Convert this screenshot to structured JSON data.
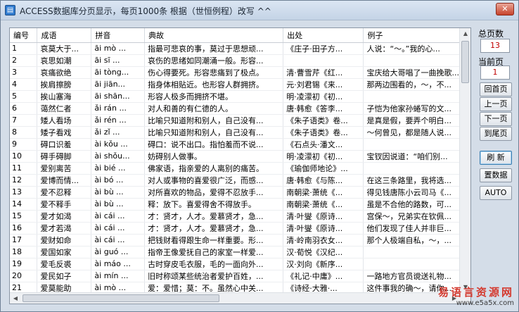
{
  "window": {
    "title": "ACCESS数据库分页显示，每页1000条 根据（世恒例程）改写 ^^",
    "close_label": "✕"
  },
  "grid": {
    "columns": [
      "编号",
      "成语",
      "拼音",
      "典故",
      "出处",
      "例子"
    ],
    "rows": [
      [
        "1",
        "哀莫大于...",
        "āi mò ...",
        "指最可悲哀的事，莫过于思想顽...",
        "《庄子·田子方...",
        "人说：“～。”我的心..."
      ],
      [
        "2",
        "哀思如潮",
        "āi sī ...",
        "哀伤的思绪如同潮涌一般。形容...",
        "",
        ""
      ],
      [
        "3",
        "哀痛欲绝",
        "āi tòng...",
        "伤心得要死。形容悲痛到了极点。",
        "清·曹雪芹《红...",
        "宝庆给大哥唱了一曲挽歌..."
      ],
      [
        "4",
        "挨肩擦膀",
        "āi jiān...",
        "指身体相贴近。也形容人群拥挤。",
        "元·刘君锡《来...",
        "那两边围看的，～，不..."
      ],
      [
        "5",
        "挨山塞海",
        "āi shān...",
        "形容人极多而拥挤不堪。",
        "明·凌濛初《初...",
        ""
      ],
      [
        "6",
        "蔼然仁者",
        "ǎi rán ...",
        "对人和善的有仁德的人。",
        "唐·韩愈《答李...",
        "子恺为他家孙蜷写的文..."
      ],
      [
        "7",
        "矮人看场",
        "ǎi rén ...",
        "比喻只知道附和别人，自己没有...",
        "《朱子语类》卷...",
        "是真是假，要弄个明白..."
      ],
      [
        "8",
        "矮子看戏",
        "ǎi zǐ ...",
        "比喻只知道附和别人，自己没有...",
        "《朱子语类》卷...",
        "～何曾见，都是随人说..."
      ],
      [
        "9",
        "碍口识羞",
        "ài kǒu ...",
        "碍口：说不出口。指怕羞而不说...",
        "《石点头·潘文...",
        ""
      ],
      [
        "10",
        "碍手碍脚",
        "ài shǒu...",
        "妨碍别人做事。",
        "明·凌濛初《初...",
        "宝钗因说道：“咱们别..."
      ],
      [
        "11",
        "爱别离苦",
        "ài bié ...",
        "佛家语，指亲爱的人离别的痛苦。",
        "《瑜伽师地论》...",
        ""
      ],
      [
        "12",
        "爱博而情...",
        "ài bó ...",
        "对人或事物的喜爱很广泛，而感...",
        "唐·韩愈《与陈...",
        "在这三条路里，我将选..."
      ],
      [
        "13",
        "爱不忍释",
        "ài bù ...",
        "对所喜欢的物品，爱得不忍放手...",
        "南朝梁·萧统《...",
        "得见钱唐陈小云司马《..."
      ],
      [
        "14",
        "爱不释手",
        "ài bù ...",
        "释：放下。喜爱得舍不得放手。",
        "南朝梁·萧统《...",
        "虽是不合他的路数，可..."
      ],
      [
        "15",
        "爱才如渴",
        "ài cái ...",
        "才：贤才，人才。爱慕贤才，急...",
        "清·叶燮《原诗...",
        "宫保～，兄弟实在钦佩..."
      ],
      [
        "16",
        "爱才若渴",
        "ài cái ...",
        "才：贤才，人才。爱慕贤才，急...",
        "清·叶燮《原诗...",
        "他们发现了佳人并非巨..."
      ],
      [
        "17",
        "爱财如命",
        "ài cái ...",
        "把钱财看得跟生命一样重要。形...",
        "清·岭南羽衣女...",
        "那个人极端自私，～，..."
      ],
      [
        "18",
        "爱国如家",
        "ài guó ...",
        "指帝王像爱抚自己的家室一样爱...",
        "汉·荀悦《汉纪...",
        ""
      ],
      [
        "19",
        "爱毛反裘",
        "ài máo ...",
        "古时穿皮毛衣服，毛的一面向外...",
        "汉·刘向《新序...",
        ""
      ],
      [
        "20",
        "爱民如子",
        "ài mín ...",
        "旧时称颂某些统治者爱护百姓，...",
        "《礼记·中庸》...",
        "一路地方官员谠送礼物..."
      ],
      [
        "21",
        "爱莫能助",
        "ài mò ...",
        "爱：爱惜；莫：不。虽然心中关...",
        "《诗经·大雅·...",
        "这件事我的确～，请你..."
      ],
      [
        "22",
        "爱钱如命",
        "ài qián...",
        "某些人贪爱钱财就像吝啬生命一...",
        "明·谢谠《四喜...",
        "1942年我在成都看见过..."
      ]
    ]
  },
  "side": {
    "total_pages_label": "总页数",
    "total_pages_value": "13",
    "current_page_label": "当前页",
    "current_page_value": "1",
    "buttons": {
      "first": "回首页",
      "prev": "上一页",
      "next": "下一页",
      "last": "到尾页",
      "refresh": "刷 新",
      "reset": "置数据",
      "auto": "AUTO"
    }
  },
  "watermark": {
    "cn": "易语言资源网",
    "url": "www.e5a5x.com"
  }
}
